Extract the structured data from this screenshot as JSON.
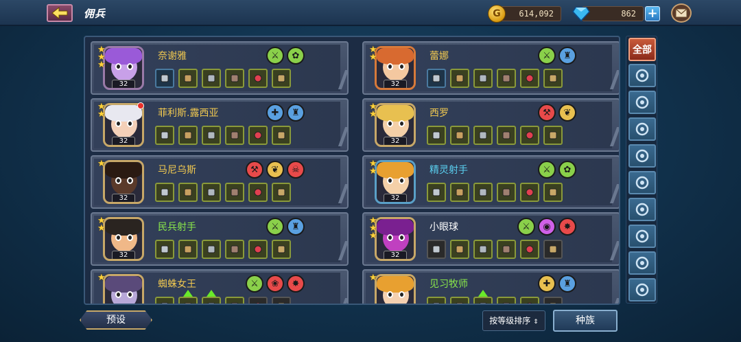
{
  "header": {
    "title": "佣兵"
  },
  "resources": {
    "gold": "614,092",
    "gems": "862",
    "coin_glyph": "G"
  },
  "filters": {
    "all_label": "全部",
    "icons": [
      "hammer-class-icon",
      "tower-class-icon",
      "bow-class-icon",
      "shield-class-icon",
      "shuriken-class-icon",
      "blade-class-icon",
      "cross-class-icon",
      "swirl-class-icon",
      "ring-class-icon"
    ]
  },
  "heroes": [
    {
      "name": "奈谢雅",
      "name_color": "#f0c850",
      "level": "32",
      "stars": 3,
      "red_dot": false,
      "skin": "#c8a0e8",
      "hair": "#9a5ad8",
      "frame": "#9a7aa8",
      "traits": [
        {
          "icon": "bow-trait-icon",
          "color": "#8ad04a",
          "glyph": "⚔"
        },
        {
          "icon": "beast-trait-icon",
          "color": "#8ad04a",
          "glyph": "✿"
        }
      ],
      "gear": [
        "blue",
        "",
        "",
        "",
        "",
        ""
      ]
    },
    {
      "name": "蕾娜",
      "name_color": "#f0c850",
      "level": "32",
      "stars": 2,
      "red_dot": false,
      "skin": "#f4c8a0",
      "hair": "#d86a30",
      "frame": "#d87a3a",
      "traits": [
        {
          "icon": "bow-trait-icon",
          "color": "#8ad04a",
          "glyph": "⚔"
        },
        {
          "icon": "helmet-trait-icon",
          "color": "#5aa0e0",
          "glyph": "♜"
        }
      ],
      "gear": [
        "blue",
        "",
        "",
        "",
        "",
        ""
      ]
    },
    {
      "name": "菲利斯.露西亚",
      "name_color": "#f0c850",
      "level": "32",
      "stars": 2,
      "red_dot": true,
      "skin": "#f4d0b8",
      "hair": "#e8e8f0",
      "frame": "#c8a868",
      "traits": [
        {
          "icon": "cross-trait-icon",
          "color": "#5aa0e0",
          "glyph": "✚"
        },
        {
          "icon": "helmet-trait-icon",
          "color": "#5aa0e0",
          "glyph": "♜"
        }
      ],
      "gear": [
        "",
        "",
        "",
        "",
        "",
        ""
      ]
    },
    {
      "name": "西罗",
      "name_color": "#f0c850",
      "level": "32",
      "stars": 2,
      "red_dot": false,
      "skin": "#f4d0a8",
      "hair": "#e8c050",
      "frame": "#c8a868",
      "traits": [
        {
          "icon": "hammer-trait-icon",
          "color": "#e84a4a",
          "glyph": "⚒"
        },
        {
          "icon": "wings-trait-icon",
          "color": "#e8c050",
          "glyph": "❦"
        }
      ],
      "gear": [
        "",
        "",
        "",
        "",
        "",
        ""
      ]
    },
    {
      "name": "马尼乌斯",
      "name_color": "#f0c850",
      "level": "32",
      "stars": 1,
      "red_dot": false,
      "skin": "#5a3a2a",
      "hair": "#2a1a12",
      "frame": "#c8a868",
      "traits": [
        {
          "icon": "hammer-trait-icon",
          "color": "#e84a4a",
          "glyph": "⚒"
        },
        {
          "icon": "wings-trait-icon",
          "color": "#e8c050",
          "glyph": "❦"
        },
        {
          "icon": "demon-trait-icon",
          "color": "#e84a4a",
          "glyph": "☠"
        }
      ],
      "gear": [
        "",
        "",
        "",
        "",
        "",
        ""
      ]
    },
    {
      "name": "精灵射手",
      "name_color": "#5ad0f0",
      "level": "32",
      "stars": 2,
      "red_dot": false,
      "skin": "#f4d0a8",
      "hair": "#e8a030",
      "frame": "#5aa0c8",
      "traits": [
        {
          "icon": "bow-trait-icon",
          "color": "#8ad04a",
          "glyph": "⚔"
        },
        {
          "icon": "beast-trait-icon",
          "color": "#8ad04a",
          "glyph": "✿"
        }
      ],
      "gear": [
        "",
        "",
        "",
        "",
        "",
        ""
      ]
    },
    {
      "name": "民兵射手",
      "name_color": "#8ae84a",
      "level": "32",
      "stars": 2,
      "red_dot": false,
      "skin": "#f0b888",
      "hair": "#2a2420",
      "frame": "#c8a868",
      "traits": [
        {
          "icon": "bow-trait-icon",
          "color": "#8ad04a",
          "glyph": "⚔"
        },
        {
          "icon": "helmet-trait-icon",
          "color": "#5aa0e0",
          "glyph": "♜"
        }
      ],
      "gear": [
        "",
        "",
        "",
        "",
        "",
        ""
      ]
    },
    {
      "name": "小眼球",
      "name_color": "#ffffff",
      "level": "32",
      "stars": 3,
      "red_dot": false,
      "skin": "#c040c0",
      "hair": "#7a2090",
      "frame": "#c8a868",
      "traits": [
        {
          "icon": "bow-trait-icon",
          "color": "#8ad04a",
          "glyph": "⚔"
        },
        {
          "icon": "eye-trait-icon",
          "color": "#d060e8",
          "glyph": "◉"
        },
        {
          "icon": "spider-trait-icon",
          "color": "#e84a4a",
          "glyph": "✸"
        }
      ],
      "gear": [
        "gray",
        "",
        "",
        "",
        "",
        "gray"
      ]
    },
    {
      "name": "蜘蛛女王",
      "name_color": "#f0c850",
      "level": "32",
      "stars": 1,
      "red_dot": false,
      "skin": "#b8a8d8",
      "hair": "#5a4a7a",
      "frame": "#c8a868",
      "traits": [
        {
          "icon": "bow-trait-icon",
          "color": "#8ad04a",
          "glyph": "⚔"
        },
        {
          "icon": "paw-trait-icon",
          "color": "#e84a4a",
          "glyph": "❀"
        },
        {
          "icon": "spider-trait-icon",
          "color": "#e84a4a",
          "glyph": "✸"
        }
      ],
      "gear": [
        "",
        "up",
        "up",
        "",
        "gray",
        "gray"
      ]
    },
    {
      "name": "见习牧师",
      "name_color": "#8ae84a",
      "level": "32",
      "stars": 1,
      "red_dot": false,
      "skin": "#f4d0b0",
      "hair": "#e8a030",
      "frame": "#c8a868",
      "traits": [
        {
          "icon": "cross-trait-icon",
          "color": "#e8c050",
          "glyph": "✚"
        },
        {
          "icon": "helmet-trait-icon",
          "color": "#5aa0e0",
          "glyph": "♜"
        }
      ],
      "gear": [
        "",
        "",
        "up",
        "",
        "",
        "gray"
      ]
    }
  ],
  "bottom": {
    "preset_label": "预设",
    "sort_label": "按等级排序",
    "race_label": "种族"
  }
}
